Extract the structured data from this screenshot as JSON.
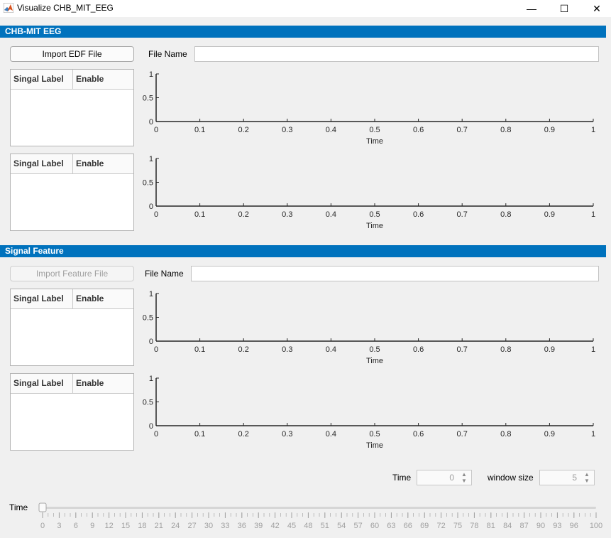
{
  "window": {
    "title": "Visualize CHB_MIT_EEG",
    "minimize": "—",
    "maximize": "☐",
    "close": "✕"
  },
  "section1": {
    "header": "CHB-MIT EEG",
    "import_button": "Import EDF File",
    "file_name_label": "File Name",
    "file_name_value": "",
    "tables": [
      {
        "col1": "Singal Label",
        "col2": "Enable"
      },
      {
        "col1": "Singal Label",
        "col2": "Enable"
      }
    ]
  },
  "section2": {
    "header": "Signal Feature",
    "import_button": "Import Feature File",
    "file_name_label": "File Name",
    "file_name_value": "",
    "tables": [
      {
        "col1": "Singal Label",
        "col2": "Enable"
      },
      {
        "col1": "Singal Label",
        "col2": "Enable"
      }
    ]
  },
  "axes": {
    "xlabel": "Time",
    "x_ticks": [
      "0",
      "0.1",
      "0.2",
      "0.3",
      "0.4",
      "0.5",
      "0.6",
      "0.7",
      "0.8",
      "0.9",
      "1"
    ],
    "y_ticks": [
      "0",
      "0.5",
      "1"
    ]
  },
  "controls": {
    "time_label": "Time",
    "time_value": "0",
    "window_size_label": "window size",
    "window_size_value": "5"
  },
  "slider": {
    "label": "Time",
    "value": 0,
    "min": 0,
    "max": 100,
    "tick_labels": [
      "0",
      "3",
      "6",
      "9",
      "12",
      "15",
      "18",
      "21",
      "24",
      "27",
      "30",
      "33",
      "36",
      "39",
      "42",
      "45",
      "48",
      "51",
      "54",
      "57",
      "60",
      "63",
      "66",
      "69",
      "72",
      "75",
      "78",
      "81",
      "84",
      "87",
      "90",
      "93",
      "96",
      "100"
    ]
  }
}
